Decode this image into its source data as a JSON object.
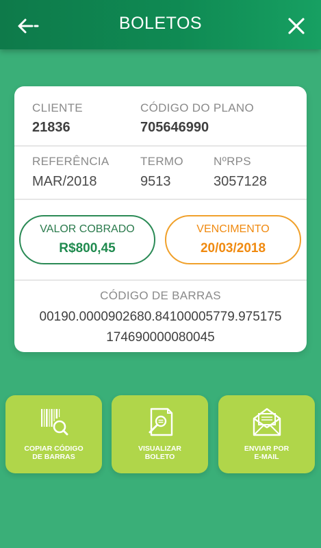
{
  "header": {
    "title": "BOLETOS",
    "back_icon": "back-arrow-icon",
    "close_icon": "close-icon"
  },
  "details": {
    "cliente_label": "CLIENTE",
    "cliente_value": "21836",
    "plano_label": "CÓDIGO DO PLANO",
    "plano_value": "705646990",
    "referencia_label": "REFERÊNCIA",
    "referencia_value": "MAR/2018",
    "termo_label": "TERMO",
    "termo_value": "9513",
    "rps_label": "NºRPS",
    "rps_value": "3057128"
  },
  "amount": {
    "label": "VALOR COBRADO",
    "value": "R$800,45",
    "color": "#1f8a4e"
  },
  "due": {
    "label": "VENCIMENTO",
    "value": "20/03/2018",
    "color": "#f08a10"
  },
  "barcode": {
    "label": "CÓDIGO DE BARRAS",
    "line1": "00190.0000902680.84100005779.975175",
    "line2": "174690000080045"
  },
  "actions": [
    {
      "label": "COPIAR CÓDIGO\nDE BARRAS",
      "icon": "barcode-search-icon"
    },
    {
      "label": "VISUALIZAR\nBOLETO",
      "icon": "document-search-icon"
    },
    {
      "label": "ENVIAR POR\nE-MAIL",
      "icon": "email-icon"
    }
  ],
  "colors": {
    "background": "#3aaf78",
    "header": "#0f8a53",
    "action_button": "#b0d64a"
  }
}
